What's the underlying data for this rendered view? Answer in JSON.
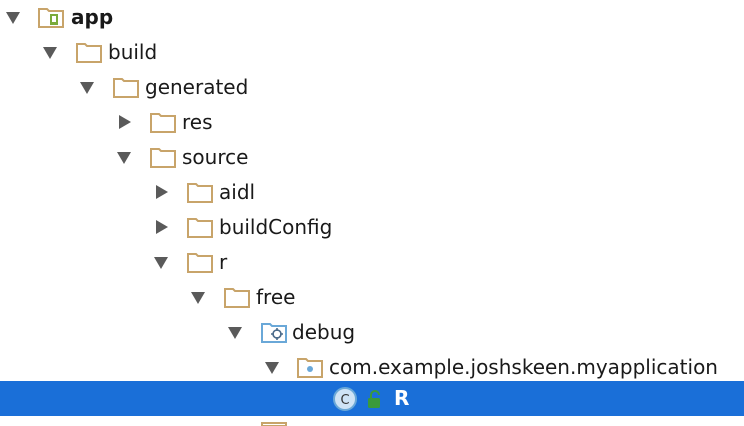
{
  "colors": {
    "folder": "#c8a46a",
    "arrow": "#5a5a5a",
    "selection": "#1a6fd8",
    "class_icon": "#6aa8d8",
    "lock_icon": "#3a9a3a"
  },
  "tree": {
    "nodes": [
      {
        "label": "app",
        "icon": "module-folder-icon",
        "expanded": true
      },
      {
        "label": "build",
        "icon": "folder-icon",
        "expanded": true
      },
      {
        "label": "generated",
        "icon": "folder-icon",
        "expanded": true
      },
      {
        "label": "res",
        "icon": "folder-icon",
        "expanded": false
      },
      {
        "label": "source",
        "icon": "folder-icon",
        "expanded": true
      },
      {
        "label": "aidl",
        "icon": "folder-icon",
        "expanded": false
      },
      {
        "label": "buildConfig",
        "icon": "folder-icon",
        "expanded": false
      },
      {
        "label": "r",
        "icon": "folder-icon",
        "expanded": true
      },
      {
        "label": "free",
        "icon": "folder-icon",
        "expanded": true
      },
      {
        "label": "debug",
        "icon": "source-folder-icon",
        "expanded": true
      },
      {
        "label": "com.example.joshskeen.myapplication",
        "icon": "package-icon",
        "expanded": true
      },
      {
        "label": "R",
        "icon": "class-icon",
        "selected": true,
        "class_letter": "C"
      }
    ]
  }
}
